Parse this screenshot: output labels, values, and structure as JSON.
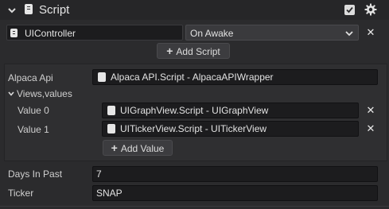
{
  "header": {
    "title": "Script",
    "enabled": true
  },
  "script_row": {
    "script_name": "UIController",
    "event": "On Awake"
  },
  "add_script_label": "Add Script",
  "alpaca_api": {
    "label": "Alpaca Api",
    "value": "Alpaca API.Script - AlpacaAPIWrapper"
  },
  "views": {
    "label": "Views,values",
    "items": [
      {
        "label": "Value 0",
        "value": "UIGraphView.Script - UIGraphView"
      },
      {
        "label": "Value 1",
        "value": "UITickerView.Script - UITickerView"
      }
    ],
    "add_value_label": "Add Value"
  },
  "days_in_past": {
    "label": "Days In Past",
    "value": "7"
  },
  "ticker": {
    "label": "Ticker",
    "value": "SNAP"
  },
  "icons": {
    "collapse": "chevron-down-icon",
    "script": "script-icon",
    "settings": "gear-icon",
    "remove": "close-icon",
    "add": "plus-icon"
  }
}
